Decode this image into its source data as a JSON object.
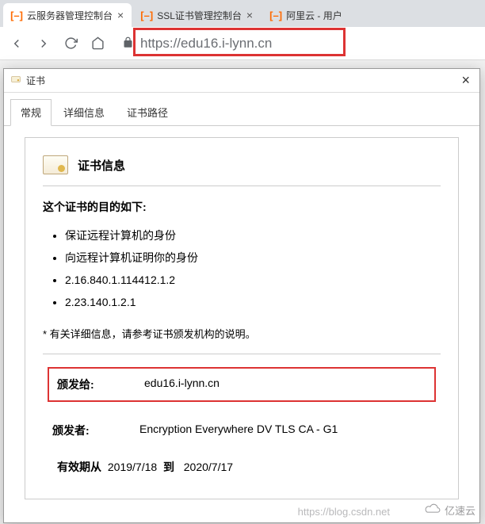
{
  "tabs": [
    {
      "title": "云服务器管理控制台",
      "active": true
    },
    {
      "title": "SSL证书管理控制台",
      "active": false
    },
    {
      "title": "阿里云 - 用户",
      "active": false
    }
  ],
  "addressbar": {
    "scheme": "https://",
    "host": "edu16.i-lynn.cn"
  },
  "dialog": {
    "title": "证书",
    "tabs": {
      "general": "常规",
      "details": "详细信息",
      "path": "证书路径"
    },
    "info_header": "证书信息",
    "purpose_title": "这个证书的目的如下:",
    "purposes": [
      "保证远程计算机的身份",
      "向远程计算机证明你的身份",
      "2.16.840.1.114412.1.2",
      "2.23.140.1.2.1"
    ],
    "note": "* 有关详细信息，请参考证书颁发机构的说明。",
    "issued_to_label": "颁发给:",
    "issued_to_value": "edu16.i-lynn.cn",
    "issuer_label": "颁发者:",
    "issuer_value": "Encryption Everywhere DV TLS CA - G1",
    "valid_from_label": "有效期从",
    "valid_from": "2019/7/18",
    "valid_to_label": "到",
    "valid_to": "2020/7/17"
  },
  "watermark": {
    "url": "https://blog.csdn.net",
    "brand": "亿速云"
  }
}
